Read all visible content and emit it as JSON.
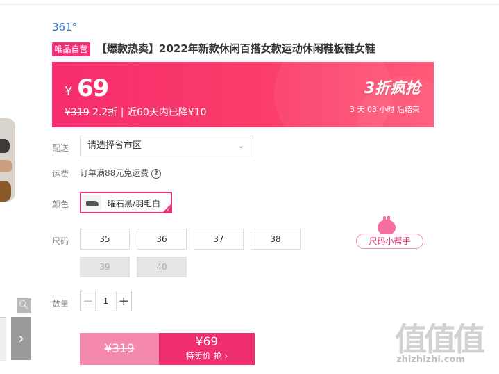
{
  "brand": "361°",
  "product": {
    "badge": "唯品自营",
    "title": "【爆款热卖】2022年新款休闲百搭女款运动休闲鞋板鞋女鞋"
  },
  "price": {
    "currency": "¥",
    "current": "69",
    "original": "¥319",
    "discount_info": " 2.2折 | 近60天内已降¥10",
    "flash_label": "3折疯抢",
    "countdown": "3 天 03 小时 后结束"
  },
  "shipping": {
    "label": "配送",
    "placeholder": "请选择省市区",
    "chevron_icon": "chevron-down-icon"
  },
  "freight": {
    "label": "运费",
    "text": "订单满88元免运费",
    "help_icon": "question-circle-icon"
  },
  "color": {
    "label": "颜色",
    "selected": "曜石黑/羽毛白"
  },
  "size": {
    "label": "尺码",
    "options": [
      {
        "value": "35",
        "available": true
      },
      {
        "value": "36",
        "available": true
      },
      {
        "value": "37",
        "available": true
      },
      {
        "value": "38",
        "available": true
      },
      {
        "value": "39",
        "available": false
      },
      {
        "value": "40",
        "available": false
      }
    ],
    "helper": "尺码小帮手"
  },
  "quantity": {
    "label": "数量",
    "value": "1"
  },
  "buy": {
    "original": "¥319",
    "price": "¥69",
    "action": "特卖价 抢"
  },
  "watermark": {
    "logo": "值值值",
    "site": "zhizhizhi.com"
  },
  "colors": {
    "accent": "#f02f6f",
    "brand_blue": "#2d72c8"
  }
}
